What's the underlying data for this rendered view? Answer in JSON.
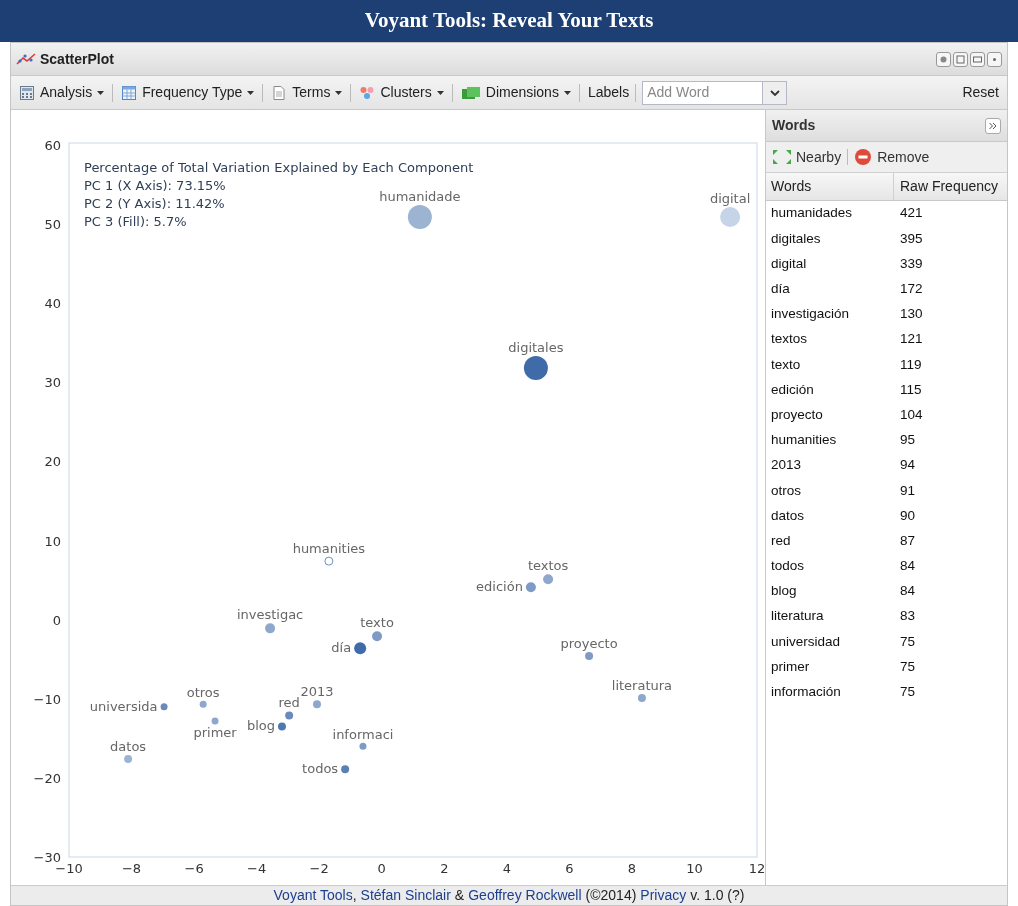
{
  "header": {
    "title": "Voyant Tools: Reveal Your Texts"
  },
  "panel": {
    "title": "ScatterPlot"
  },
  "toolbar": {
    "items": [
      {
        "kind": "menu",
        "label": "Analysis"
      },
      {
        "kind": "menu",
        "label": "Frequency Type"
      },
      {
        "kind": "menu",
        "label": "Terms"
      },
      {
        "kind": "menu",
        "label": "Clusters"
      },
      {
        "kind": "menu",
        "label": "Dimensions"
      },
      {
        "kind": "button",
        "label": "Labels"
      }
    ],
    "add_word": {
      "placeholder": "Add Word"
    },
    "reset": "Reset"
  },
  "chart": {
    "chart_data": {
      "type": "scatter",
      "title": "Percentage of Total Variation Explained by Each Component",
      "annotations": [
        "PC 1 (X Axis): 73.15%",
        "PC 2 (Y Axis): 11.42%",
        "PC 3 (Fill): 5.7%"
      ],
      "xlim": [
        -10,
        12
      ],
      "ylim": [
        -30,
        60
      ],
      "xticks": [
        {
          "value": -10,
          "label": "−10"
        },
        {
          "value": -8,
          "label": "−8"
        },
        {
          "value": -6,
          "label": "−6"
        },
        {
          "value": -4,
          "label": "−4"
        },
        {
          "value": -2,
          "label": "−2"
        },
        0,
        2,
        4,
        6,
        8,
        10,
        12
      ],
      "yticks": [
        {
          "value": -30,
          "label": "−30"
        },
        {
          "value": -20,
          "label": "−20"
        },
        {
          "value": -10,
          "label": "−10"
        },
        0,
        10,
        20,
        30,
        40,
        50,
        60
      ],
      "series": [
        {
          "name": "humanidade",
          "color": "#9db3d2",
          "x": [
            1.22
          ],
          "values": [
            50.9
          ]
        },
        {
          "name": "digital",
          "color": "#c6d4e7",
          "x": [
            11.14
          ],
          "values": [
            50.9
          ]
        },
        {
          "name": "digitales",
          "color": "#3f6ca8",
          "x": [
            4.93
          ],
          "values": [
            31.8
          ]
        },
        {
          "name": "humanities",
          "color": "#ffffff",
          "x": [
            -1.69
          ],
          "values": [
            7.4
          ]
        },
        {
          "name": "edición",
          "color": "#7f9bc5",
          "x": [
            4.77
          ],
          "values": [
            4.1
          ]
        },
        {
          "name": "textos",
          "color": "#8ea7cc",
          "x": [
            5.32
          ],
          "values": [
            5.1
          ]
        },
        {
          "name": "investigac",
          "color": "#8ea7cc",
          "x": [
            -3.57
          ],
          "values": [
            -1.1
          ]
        },
        {
          "name": "texto",
          "color": "#7f9bc5",
          "x": [
            -0.15
          ],
          "values": [
            -2.1
          ]
        },
        {
          "name": "día",
          "color": "#3f6ca8",
          "x": [
            -0.69
          ],
          "values": [
            -3.6
          ]
        },
        {
          "name": "proyecto",
          "color": "#7f9bc5",
          "x": [
            6.63
          ],
          "values": [
            -4.6
          ]
        },
        {
          "name": "literatura",
          "color": "#8ea7cc",
          "x": [
            8.32
          ],
          "values": [
            -9.9
          ]
        },
        {
          "name": "2013",
          "color": "#8ea7cc",
          "x": [
            -2.07
          ],
          "values": [
            -10.7
          ]
        },
        {
          "name": "red",
          "color": "#6a8abc",
          "x": [
            -2.96
          ],
          "values": [
            -12.1
          ]
        },
        {
          "name": "blog",
          "color": "#4f78b0",
          "x": [
            -3.19
          ],
          "values": [
            -13.5
          ]
        },
        {
          "name": "universida",
          "color": "#6a8abc",
          "x": [
            -6.96
          ],
          "values": [
            -11
          ]
        },
        {
          "name": "otros",
          "color": "#8ea7cc",
          "x": [
            -5.71
          ],
          "values": [
            -10.7
          ]
        },
        {
          "name": "primer",
          "color": "#8ea7cc",
          "x": [
            -5.33
          ],
          "values": [
            -12.8
          ]
        },
        {
          "name": "informaci",
          "color": "#7f9bc5",
          "x": [
            -0.6
          ],
          "values": [
            -16
          ]
        },
        {
          "name": "todos",
          "color": "#5a80b5",
          "x": [
            -1.17
          ],
          "values": [
            -18.9
          ]
        },
        {
          "name": "datos",
          "color": "#9db3d2",
          "x": [
            -8.11
          ],
          "values": [
            -17.6
          ]
        }
      ]
    }
  },
  "words_panel": {
    "title": "Words",
    "nearby": "Nearby",
    "remove": "Remove",
    "columns": [
      "Words",
      "Raw Frequency"
    ],
    "rows": [
      [
        "humanidades",
        "421"
      ],
      [
        "digitales",
        "395"
      ],
      [
        "digital",
        "339"
      ],
      [
        "día",
        "172"
      ],
      [
        "investigación",
        "130"
      ],
      [
        "textos",
        "121"
      ],
      [
        "texto",
        "119"
      ],
      [
        "edición",
        "115"
      ],
      [
        "proyecto",
        "104"
      ],
      [
        "humanities",
        "95"
      ],
      [
        "2013",
        "94"
      ],
      [
        "otros",
        "91"
      ],
      [
        "datos",
        "90"
      ],
      [
        "red",
        "87"
      ],
      [
        "todos",
        "84"
      ],
      [
        "blog",
        "84"
      ],
      [
        "literatura",
        "83"
      ],
      [
        "universidad",
        "75"
      ],
      [
        "primer",
        "75"
      ],
      [
        "información",
        "75"
      ]
    ]
  },
  "footer": {
    "parts": [
      {
        "kind": "link",
        "text": "Voyant Tools"
      },
      {
        "kind": "text",
        "text": ","
      },
      {
        "kind": "link",
        "text": "Stéfan Sinclair"
      },
      {
        "kind": "text",
        "text": "&"
      },
      {
        "kind": "link",
        "text": "Geoffrey Rockwell"
      },
      {
        "kind": "text",
        "text": "(©2014)"
      },
      {
        "kind": "link",
        "text": "Privacy"
      },
      {
        "kind": "text",
        "text": "v. 1.0 (?)"
      }
    ]
  }
}
